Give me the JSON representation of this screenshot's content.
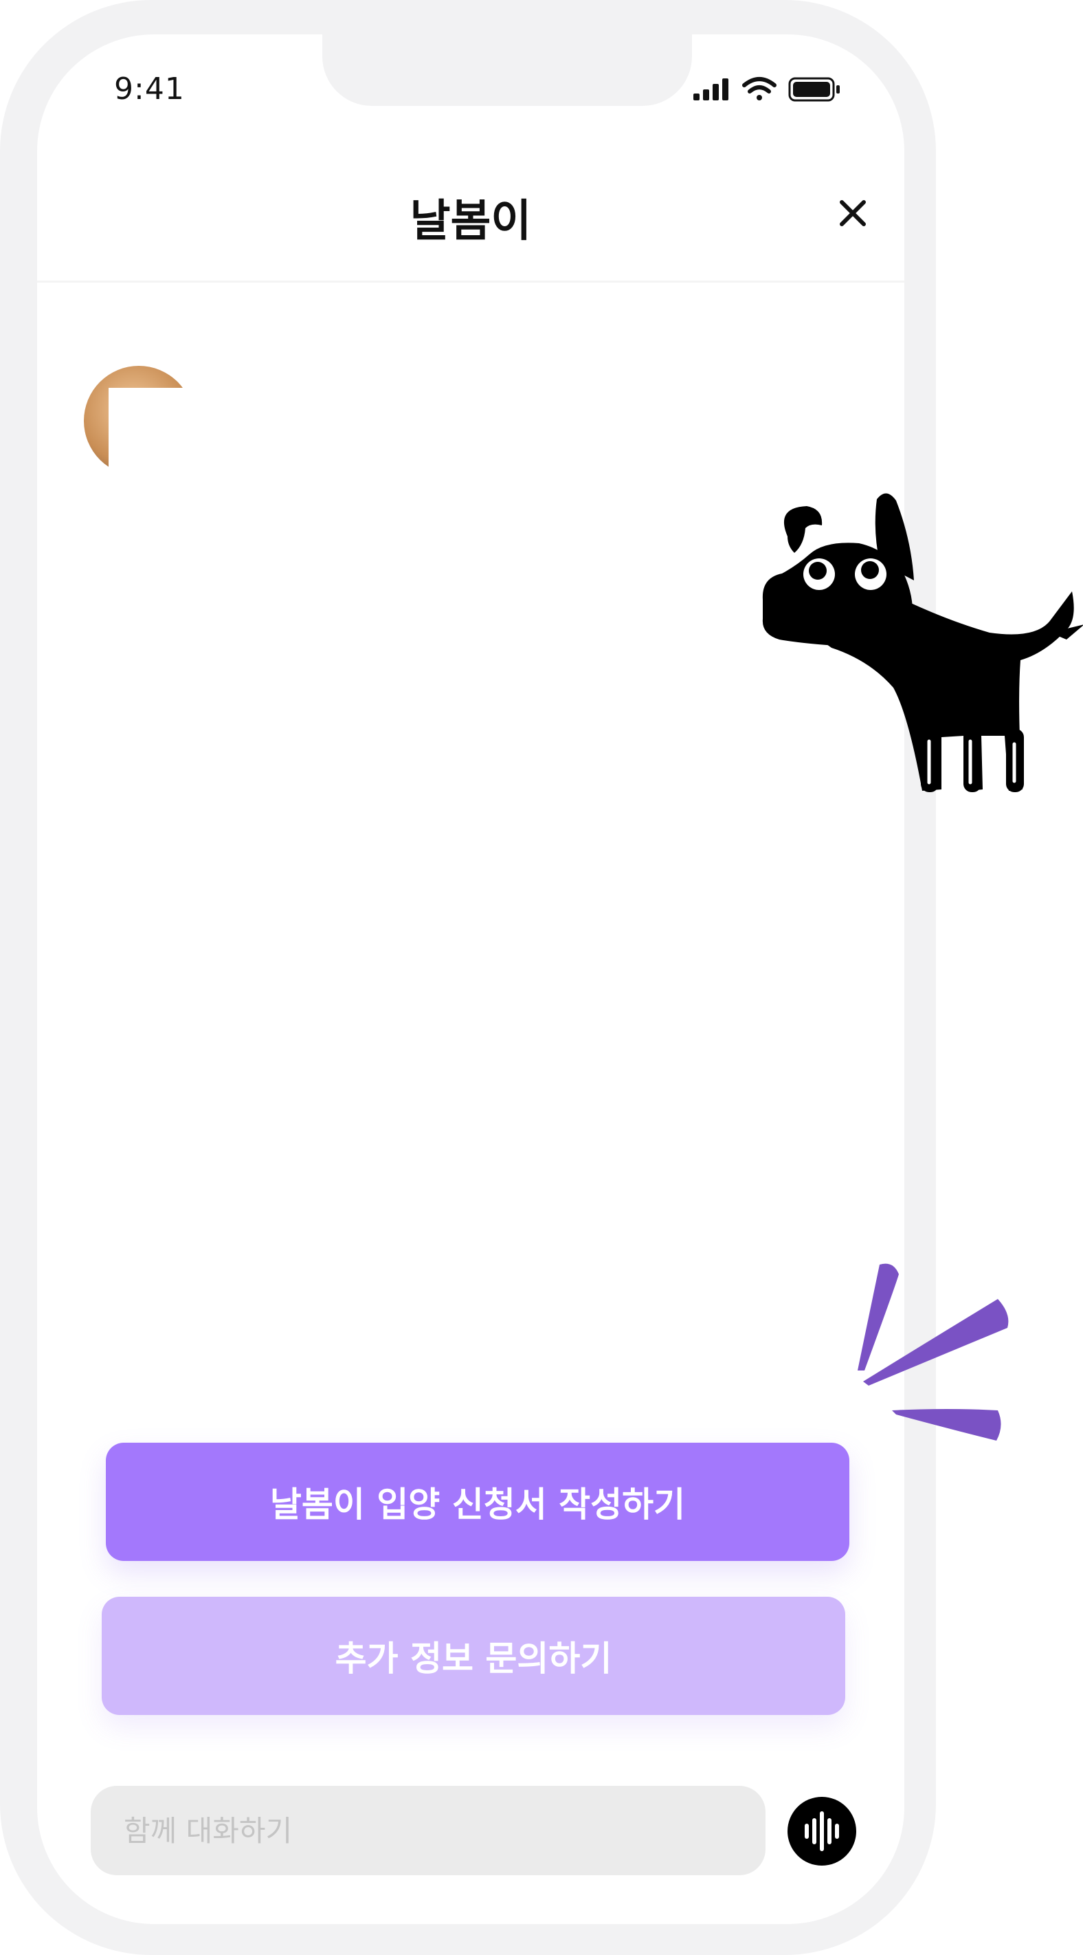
{
  "status_bar": {
    "time": "9:41",
    "icons": [
      "cellular-signal-icon",
      "wifi-icon",
      "battery-icon"
    ]
  },
  "header": {
    "title": "날봄이",
    "close_icon": "close-icon"
  },
  "actions": {
    "primary_label": "날봄이 입양 신청서 작성하기",
    "secondary_label": "추가 정보 문의하기"
  },
  "chat_input": {
    "placeholder": "함께 대화하기",
    "voice_icon": "voice-waveform-icon"
  },
  "colors": {
    "primary": "#a378fc",
    "secondary": "#cfb8fc",
    "accent_purple": "#7a52c4",
    "frame": "#f2f2f3",
    "input_bg": "#ebebeb"
  }
}
